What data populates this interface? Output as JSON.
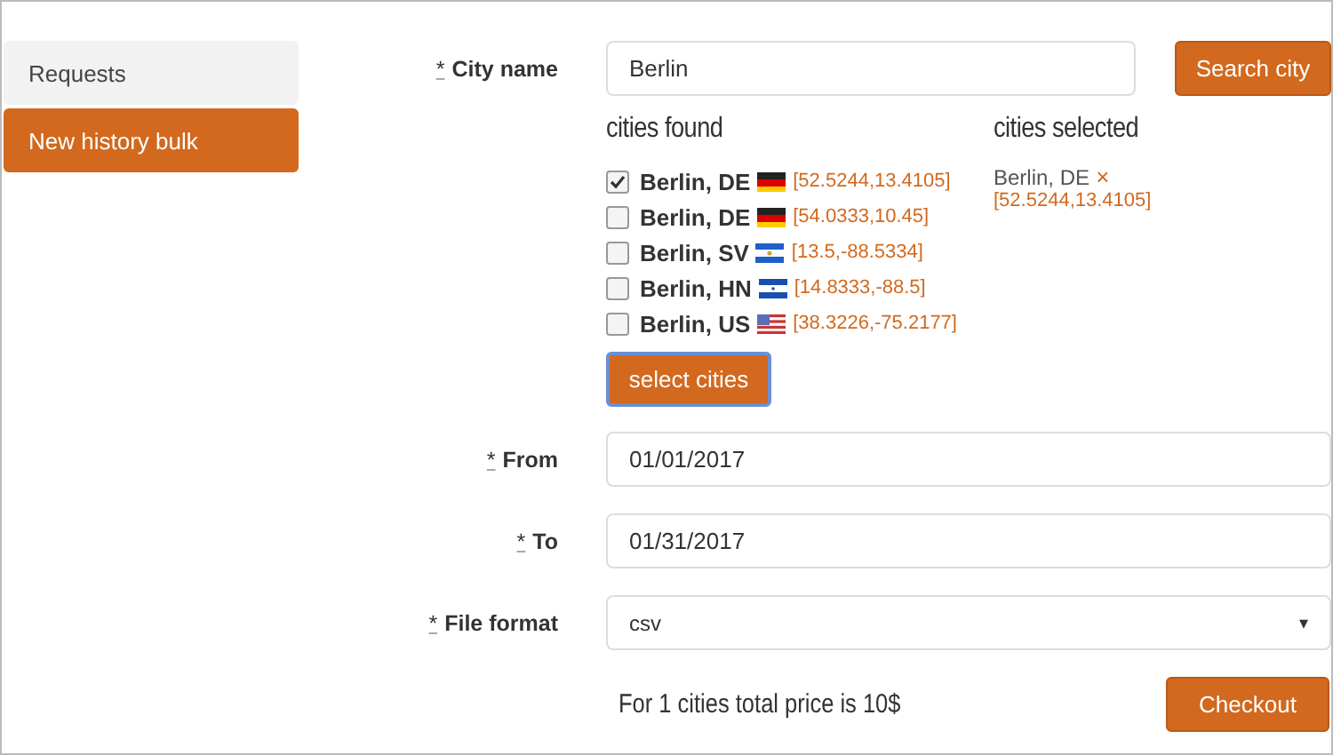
{
  "sidebar": {
    "items": [
      {
        "label": "Requests",
        "selected": false
      },
      {
        "label": "New history bulk",
        "selected": true
      }
    ]
  },
  "city_field": {
    "mark": "*",
    "label": "City name",
    "value": "Berlin"
  },
  "search_button": "Search city",
  "cities_found": {
    "title": "cities found",
    "items": [
      {
        "name": "Berlin, DE",
        "kind": "de",
        "coords": "[52.5244,13.4105]",
        "checked": true
      },
      {
        "name": "Berlin, DE",
        "kind": "de",
        "coords": "[54.0333,10.45]",
        "checked": false
      },
      {
        "name": "Berlin, SV",
        "kind": "sv",
        "coords": "[13.5,-88.5334]",
        "checked": false
      },
      {
        "name": "Berlin, HN",
        "kind": "hn",
        "coords": "[14.8333,-88.5]",
        "checked": false
      },
      {
        "name": "Berlin, US",
        "kind": "us",
        "coords": "[38.3226,-75.2177]",
        "checked": false
      }
    ]
  },
  "cities_selected": {
    "title": "cities selected",
    "items": [
      {
        "name": "Berlin, DE",
        "remove": "×",
        "coords": "[52.5244,13.4105]"
      }
    ]
  },
  "select_button": "select cities",
  "fields": [
    {
      "kind": "input",
      "mark": "*",
      "label": "From",
      "value": "01/01/2017"
    },
    {
      "kind": "input",
      "mark": "*",
      "label": "To",
      "value": "01/31/2017"
    },
    {
      "kind": "select",
      "mark": "*",
      "label": "File format",
      "value": "csv",
      "caret": "▾"
    }
  ],
  "price_text": "For 1 cities total price is 10$",
  "checkout_button": "Checkout"
}
